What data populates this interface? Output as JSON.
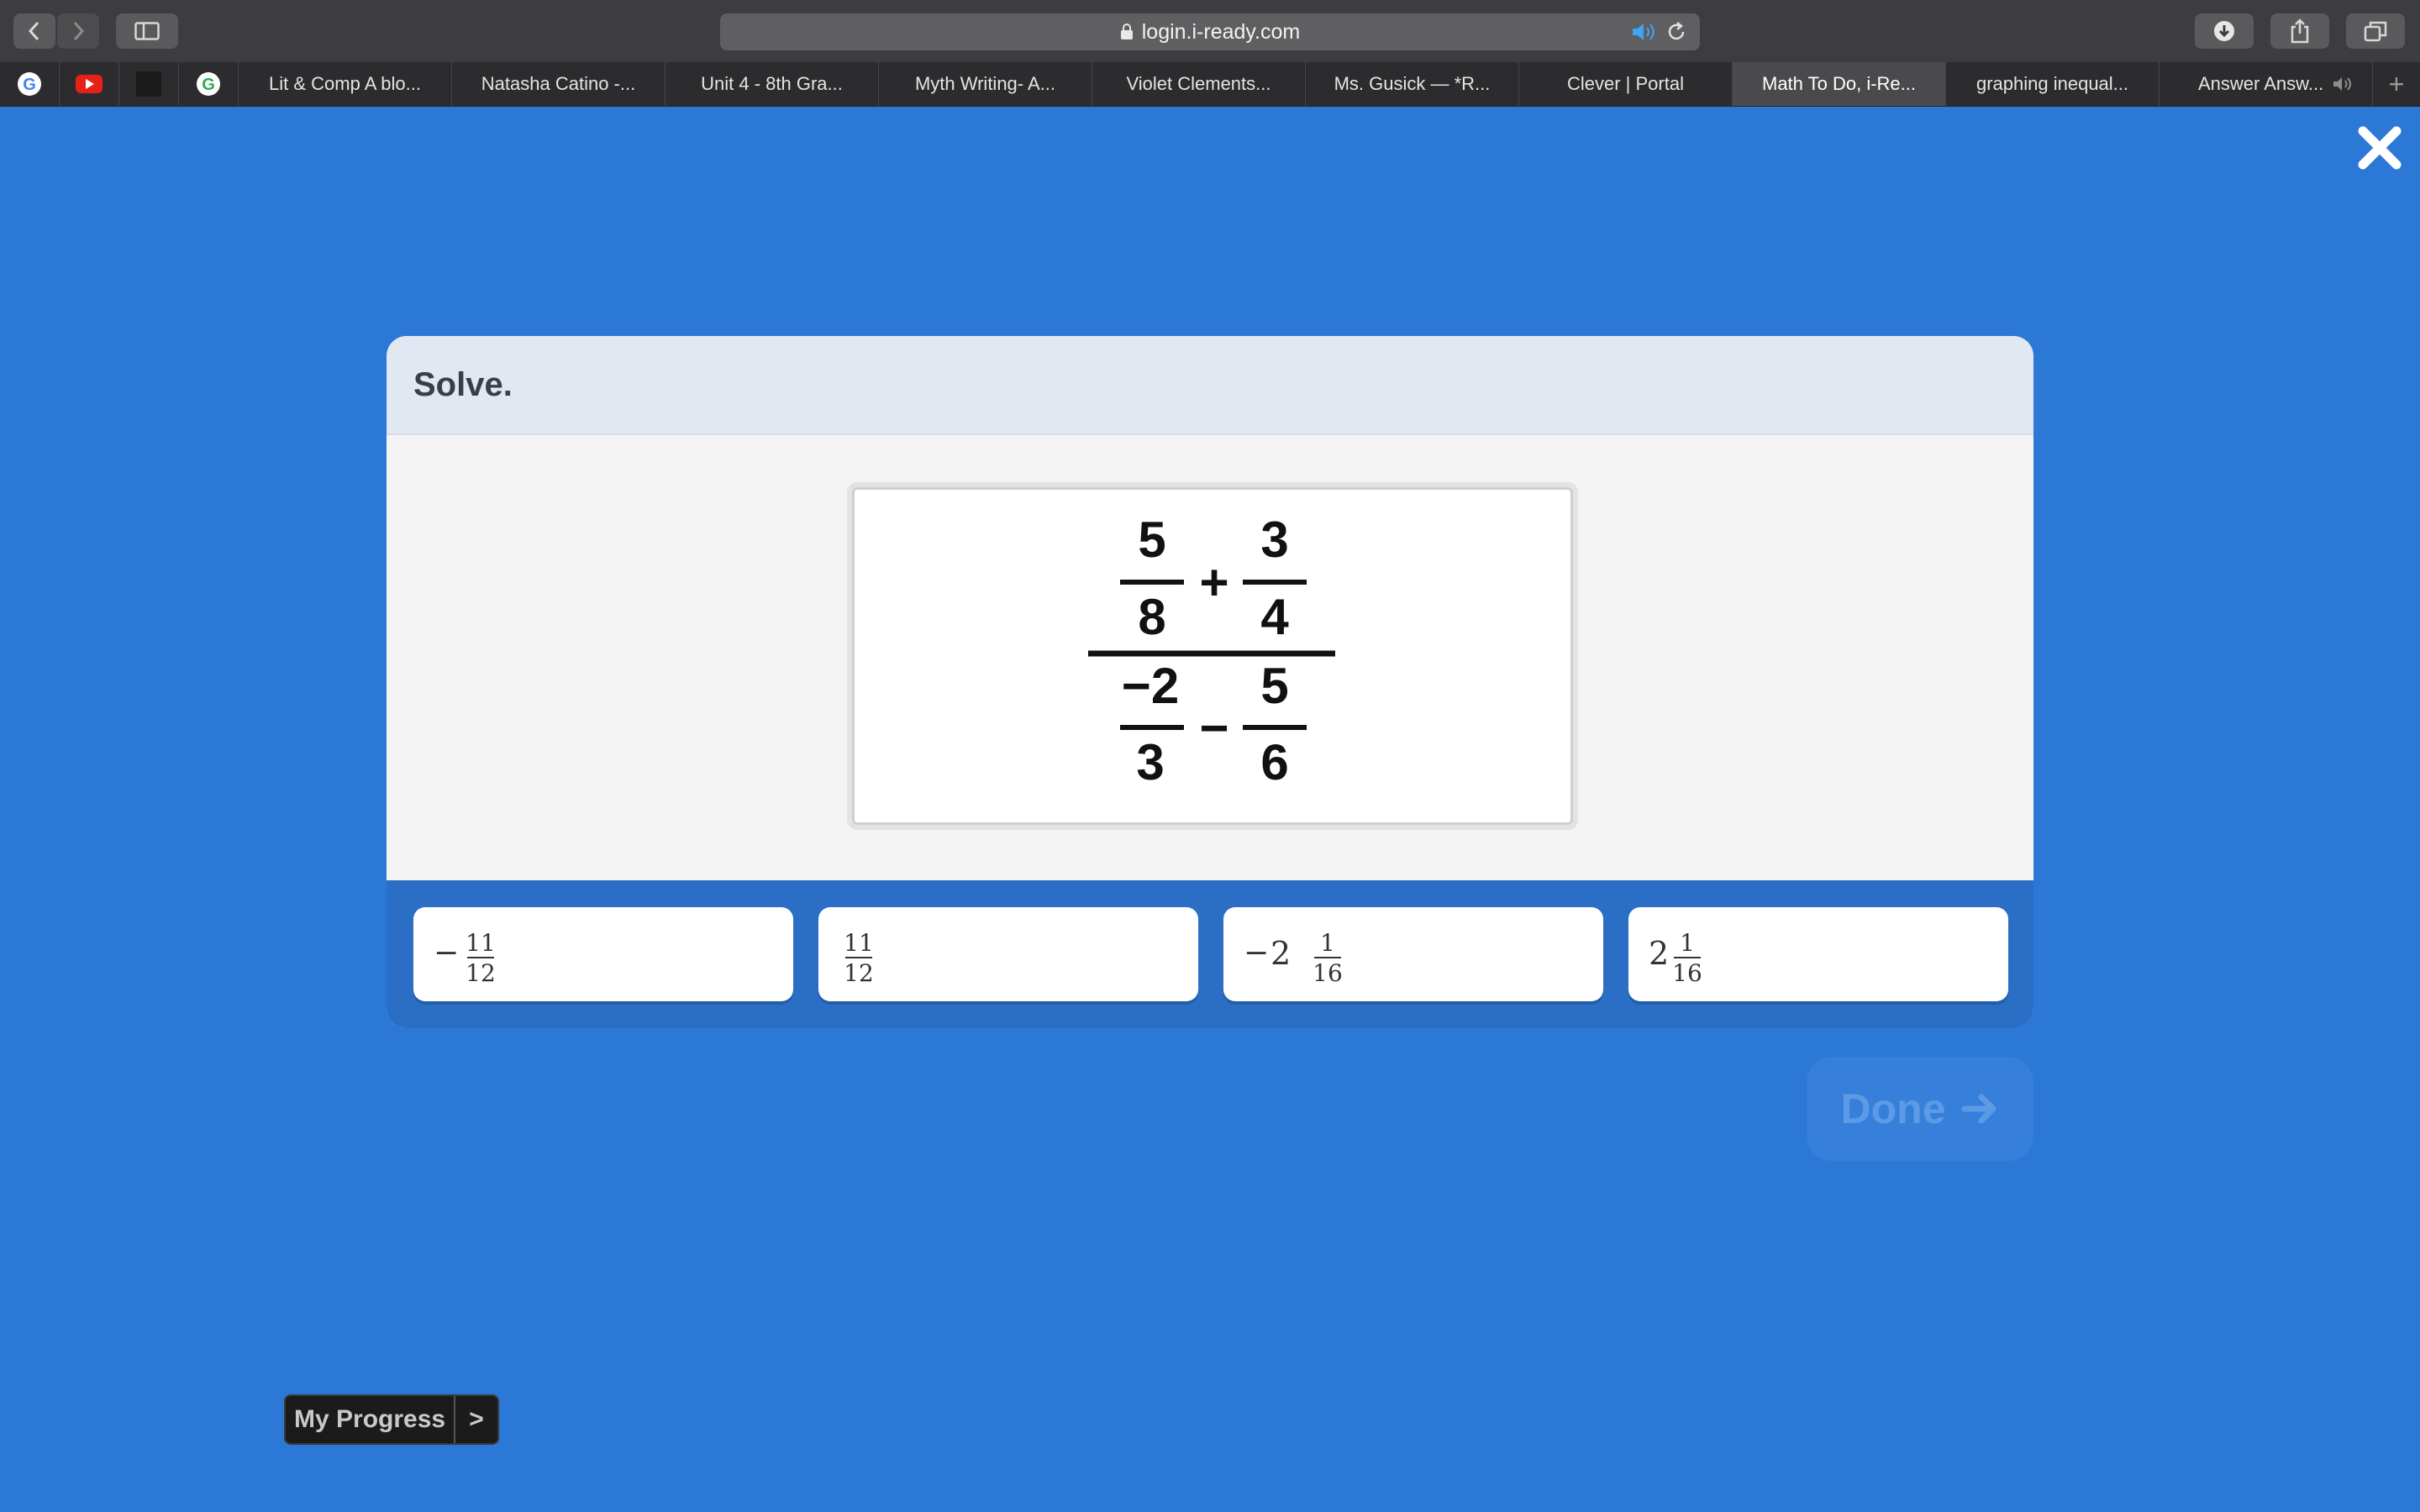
{
  "browser": {
    "url": "login.i-ready.com",
    "tabs": [
      {
        "label": "Lit & Comp A blo..."
      },
      {
        "label": "Natasha Catino -..."
      },
      {
        "label": "Unit 4 - 8th Gra..."
      },
      {
        "label": "Myth Writing- A..."
      },
      {
        "label": "Violet Clements..."
      },
      {
        "label": "Ms. Gusick — *R..."
      },
      {
        "label": "Clever | Portal"
      },
      {
        "label": "Math To Do, i-Re..."
      },
      {
        "label": "graphing inequal..."
      },
      {
        "label": "Answer Answ..."
      }
    ],
    "active_tab": 7,
    "plus_label": "+"
  },
  "question": {
    "prompt": "Solve.",
    "expression": {
      "top_left": {
        "num": "5",
        "den": "8"
      },
      "top_op": "+",
      "top_right": {
        "num": "3",
        "den": "4"
      },
      "bottom_left": {
        "num": "−2",
        "den": "3"
      },
      "bottom_op": "−",
      "bottom_right": {
        "num": "5",
        "den": "6"
      }
    }
  },
  "answers": [
    {
      "sign": "−",
      "whole": "",
      "num": "11",
      "den": "12"
    },
    {
      "sign": "",
      "whole": "",
      "num": "11",
      "den": "12"
    },
    {
      "sign": "−",
      "whole": "2",
      "num": "1",
      "den": "16"
    },
    {
      "sign": "",
      "whole": "2",
      "num": "1",
      "den": "16"
    }
  ],
  "done": {
    "label": "Done"
  },
  "progress": {
    "label": "My Progress",
    "chevron": ">"
  },
  "colors": {
    "page_bg": "#2b78d6",
    "answer_bar": "#2a6ec6",
    "done_text": "#5d9ae5"
  }
}
